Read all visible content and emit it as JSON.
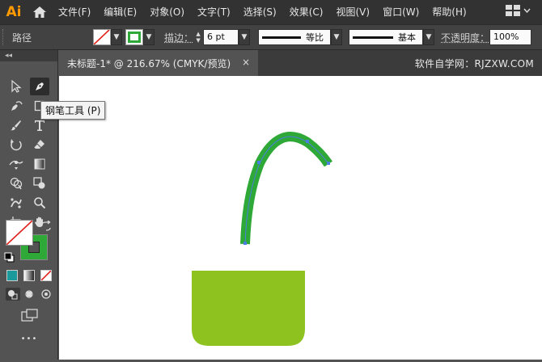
{
  "app": {
    "logo": "Ai"
  },
  "menu": [
    "文件(F)",
    "编辑(E)",
    "对象(O)",
    "文字(T)",
    "选择(S)",
    "效果(C)",
    "视图(V)",
    "窗口(W)",
    "帮助(H)"
  ],
  "control": {
    "mode_label": "路径",
    "stroke_label": "描边：",
    "stroke_width": "6 pt",
    "profile_label": "等比",
    "brush_label": "基本",
    "opacity_label": "不透明度：",
    "opacity_value": "100%"
  },
  "document": {
    "tab_title": "未标题-1* @ 216.67% (CMYK/预览)",
    "close_glyph": "×",
    "watermark": "软件自学网：RJZXW.COM"
  },
  "tooltip": {
    "text": "钢笔工具 (P)"
  },
  "tools": {
    "collapse_glyph": "◂◂",
    "more_glyph": "•••",
    "icons": [
      "selection-icon",
      "pen-icon",
      "curvature-icon",
      "rectangle-icon",
      "paintbrush-icon",
      "type-icon",
      "rotate-icon",
      "eraser-icon",
      "width-icon",
      "gradient-icon",
      "shape-builder-icon",
      "live-paint-icon",
      "puppet-warp-icon",
      "zoom-icon",
      "artboard-icon",
      "hand-icon"
    ]
  },
  "colors": {
    "fill": "none",
    "stroke": "#2ea836",
    "bucket": "#8dc21f",
    "accent": "#ff9a00"
  }
}
